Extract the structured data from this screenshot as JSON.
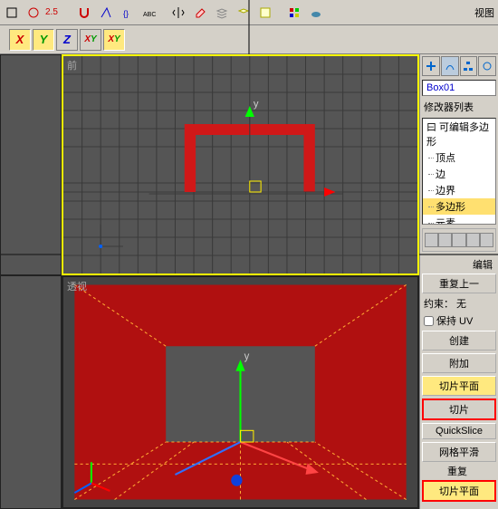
{
  "toolbar1": {
    "spinner_value": "2.5",
    "view_label": "视图"
  },
  "axis_bar": {
    "x": "X",
    "y": "Y",
    "z": "Z",
    "xy": "XY",
    "xy2": "XY"
  },
  "viewports": {
    "front_label": "前",
    "persp_label": "透视",
    "gizmo_y": "y"
  },
  "side": {
    "object_name": "Box01",
    "modifier_list_label": "修改器列表",
    "modstack": {
      "root": "曰 可编辑多边形",
      "items": [
        "顶点",
        "边",
        "边界",
        "多边形",
        "元素"
      ],
      "selected_index": 3
    },
    "rollup": {
      "edit_label": "编辑",
      "repeat_last": "重复上一",
      "constraint_label": "约束：",
      "constraint_value": "无",
      "preserve_uv": "保持 UV",
      "create": "创建",
      "attach": "附加",
      "slice_plane": "切片平面",
      "slice": "切片",
      "quickslice": "QuickSlice",
      "mesh_smooth": "网格平滑",
      "iterate": "重复",
      "slice_plane2": "切片平面"
    }
  }
}
